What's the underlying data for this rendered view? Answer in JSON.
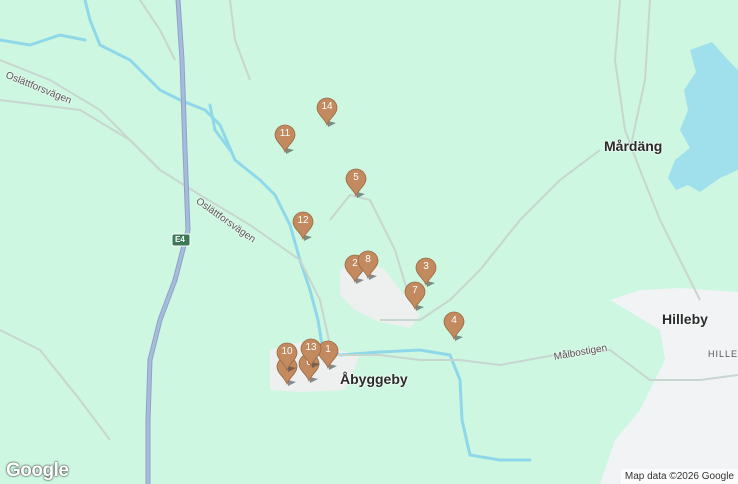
{
  "map": {
    "places": {
      "abyggeby": "Åbyggeby",
      "mardang": "Mårdäng",
      "hilleby": "Hilleby",
      "hille": "HILLE"
    },
    "roads": {
      "oslattforsvagen_1": "Oslättforsvägen",
      "oslattforsvagen_2": "Oslättforsvägen",
      "malbostigen": "Målbostigen",
      "e4_shield": "E4"
    },
    "markers": [
      {
        "id": "m1",
        "label": "1"
      },
      {
        "id": "m2",
        "label": "2"
      },
      {
        "id": "m3",
        "label": "3"
      },
      {
        "id": "m4",
        "label": "4"
      },
      {
        "id": "m5",
        "label": "5"
      },
      {
        "id": "m6",
        "label": "6"
      },
      {
        "id": "m7",
        "label": "7"
      },
      {
        "id": "m8",
        "label": "8"
      },
      {
        "id": "m9",
        "label": "9"
      },
      {
        "id": "m10",
        "label": "10"
      },
      {
        "id": "m11",
        "label": "11"
      },
      {
        "id": "m12",
        "label": "12"
      },
      {
        "id": "m13",
        "label": "13"
      },
      {
        "id": "m14",
        "label": "14"
      }
    ],
    "marker_color": "#c28a5e",
    "logo": "Google",
    "attribution": "Map data ©2026 Google"
  }
}
